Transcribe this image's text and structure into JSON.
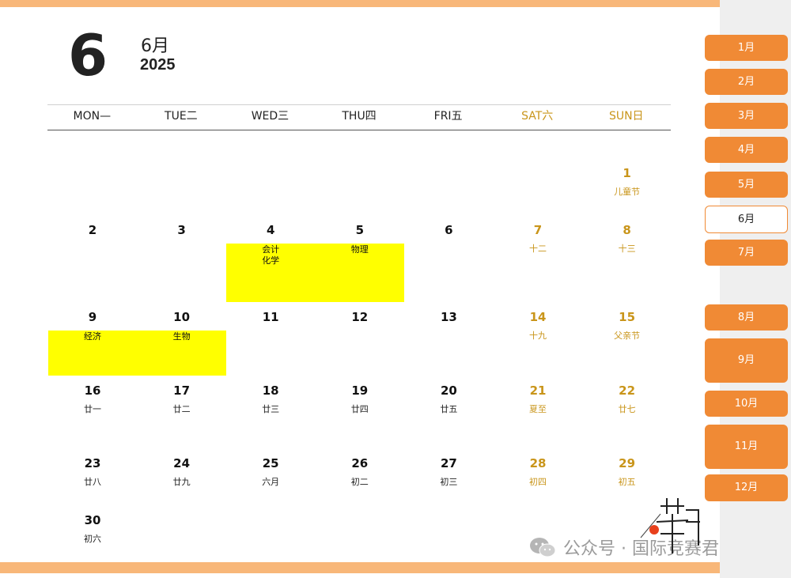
{
  "header": {
    "month_number": "6",
    "month_label": "6月",
    "year": "2025"
  },
  "weekdays": [
    {
      "label": "MON—",
      "weekend": false
    },
    {
      "label": "TUE二",
      "weekend": false
    },
    {
      "label": "WED三",
      "weekend": false
    },
    {
      "label": "THU四",
      "weekend": false
    },
    {
      "label": "FRI五",
      "weekend": false
    },
    {
      "label": "SAT六",
      "weekend": true
    },
    {
      "label": "SUN日",
      "weekend": true
    }
  ],
  "weeks": [
    [
      null,
      null,
      null,
      null,
      null,
      null,
      {
        "day": "1",
        "sub": "儿童节"
      }
    ],
    [
      {
        "day": "2",
        "sub": ""
      },
      {
        "day": "3",
        "sub": ""
      },
      {
        "day": "4",
        "sub": ""
      },
      {
        "day": "5",
        "sub": ""
      },
      {
        "day": "6",
        "sub": ""
      },
      {
        "day": "7",
        "sub": "十二"
      },
      {
        "day": "8",
        "sub": "十三"
      }
    ],
    [
      {
        "day": "9",
        "sub": ""
      },
      {
        "day": "10",
        "sub": ""
      },
      {
        "day": "11",
        "sub": ""
      },
      {
        "day": "12",
        "sub": ""
      },
      {
        "day": "13",
        "sub": ""
      },
      {
        "day": "14",
        "sub": "十九"
      },
      {
        "day": "15",
        "sub": "父亲节"
      }
    ],
    [
      {
        "day": "16",
        "sub": "廿一"
      },
      {
        "day": "17",
        "sub": "廿二"
      },
      {
        "day": "18",
        "sub": "廿三"
      },
      {
        "day": "19",
        "sub": "廿四"
      },
      {
        "day": "20",
        "sub": "廿五"
      },
      {
        "day": "21",
        "sub": "夏至"
      },
      {
        "day": "22",
        "sub": "廿七"
      }
    ],
    [
      {
        "day": "23",
        "sub": "廿八"
      },
      {
        "day": "24",
        "sub": "廿九"
      },
      {
        "day": "25",
        "sub": "六月"
      },
      {
        "day": "26",
        "sub": "初二"
      },
      {
        "day": "27",
        "sub": "初三"
      },
      {
        "day": "28",
        "sub": "初四"
      },
      {
        "day": "29",
        "sub": "初五"
      }
    ],
    [
      {
        "day": "30",
        "sub": "初六"
      },
      null,
      null,
      null,
      null,
      null,
      null
    ]
  ],
  "exams": [
    {
      "day": "4",
      "subjects": "会计\n化学"
    },
    {
      "day": "5",
      "subjects": "物理"
    },
    {
      "day": "9",
      "subjects": "经济"
    },
    {
      "day": "10",
      "subjects": "生物"
    }
  ],
  "highlight_color": "#ffff00",
  "accent_color": "#f08a35",
  "weekend_color": "#c9951a",
  "month_nav": [
    {
      "label": "1月",
      "active": false
    },
    {
      "label": "2月",
      "active": false
    },
    {
      "label": "3月",
      "active": false
    },
    {
      "label": "4月",
      "active": false
    },
    {
      "label": "5月",
      "active": false
    },
    {
      "label": "6月",
      "active": true
    },
    {
      "label": "7月",
      "active": false
    },
    {
      "label": "8月",
      "active": false
    },
    {
      "label": "9月",
      "active": false
    },
    {
      "label": "10月",
      "active": false
    },
    {
      "label": "11月",
      "active": false
    },
    {
      "label": "12月",
      "active": false
    }
  ],
  "footer": {
    "wechat_text": "公众号 · 国际竞赛君",
    "icon": "wechat-icon"
  }
}
